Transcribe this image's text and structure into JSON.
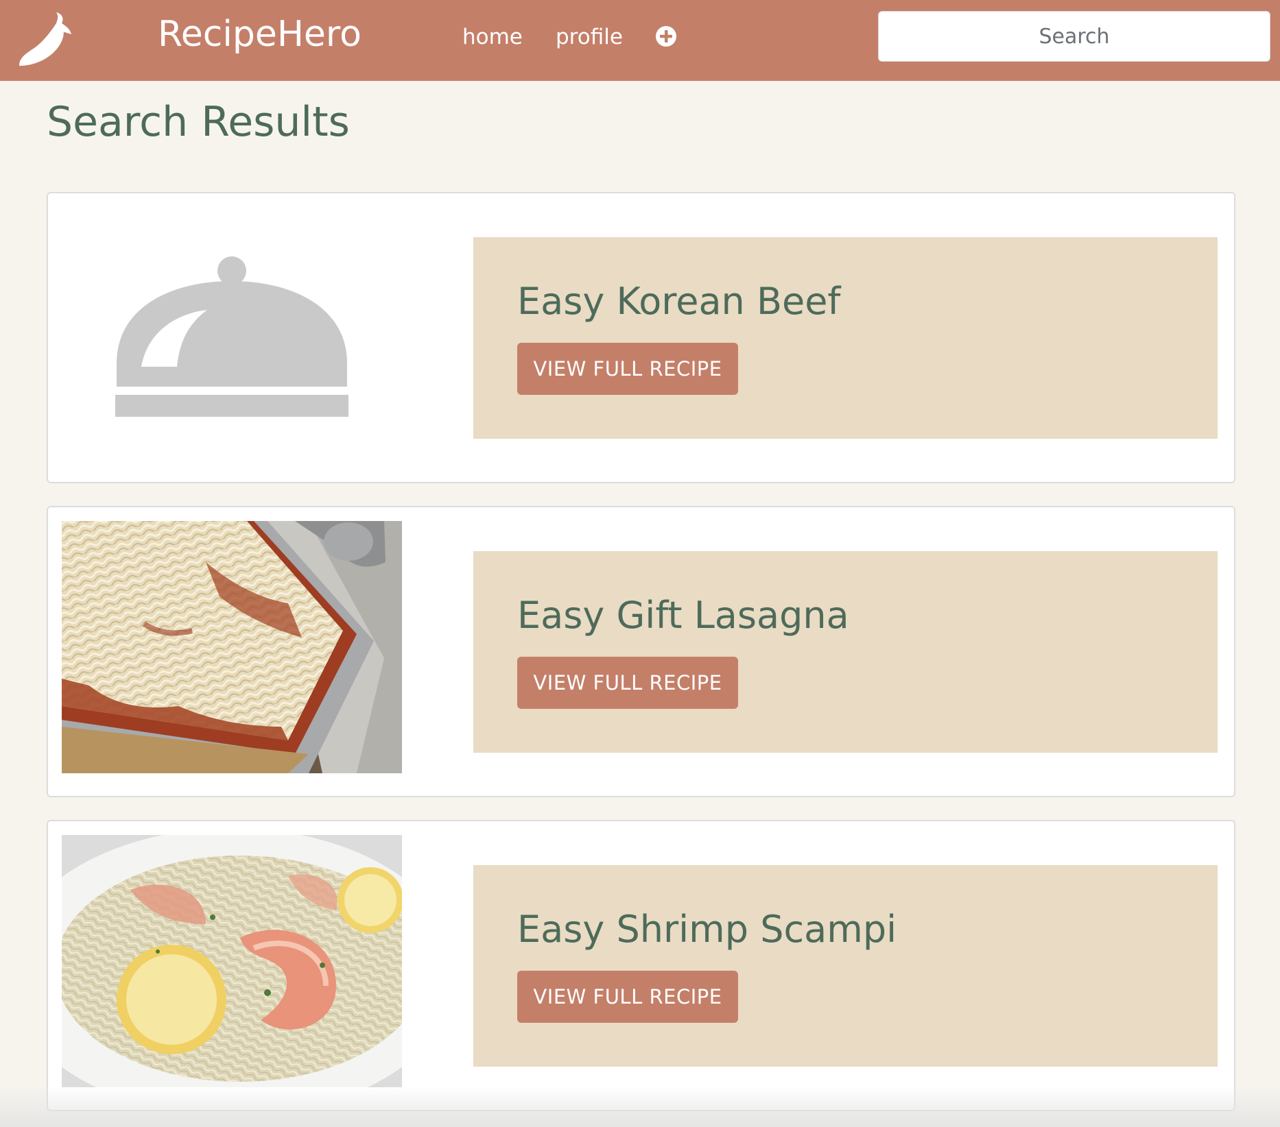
{
  "navbar": {
    "brand_name": "RecipeHero",
    "logo_icon": "chili-pepper-icon",
    "links": {
      "home": "home",
      "profile": "profile"
    },
    "add_icon": "plus-circle-icon",
    "search_placeholder": "Search"
  },
  "page": {
    "title": "Search Results"
  },
  "results": [
    {
      "title": "Easy Korean Beef",
      "button_label": "VIEW FULL RECIPE",
      "image": "placeholder-cloche-icon"
    },
    {
      "title": "Easy Gift Lasagna",
      "button_label": "VIEW FULL RECIPE",
      "image": "lasagna-photo"
    },
    {
      "title": "Easy Shrimp Scampi",
      "button_label": "VIEW FULL RECIPE",
      "image": "shrimp-scampi-photo"
    }
  ],
  "colors": {
    "primary": "#c47f69",
    "accent_green": "#4e6b5a",
    "card_panel": "#e9dbc4",
    "background": "#f7f4ee",
    "placeholder_gray": "#c9c9c9"
  }
}
